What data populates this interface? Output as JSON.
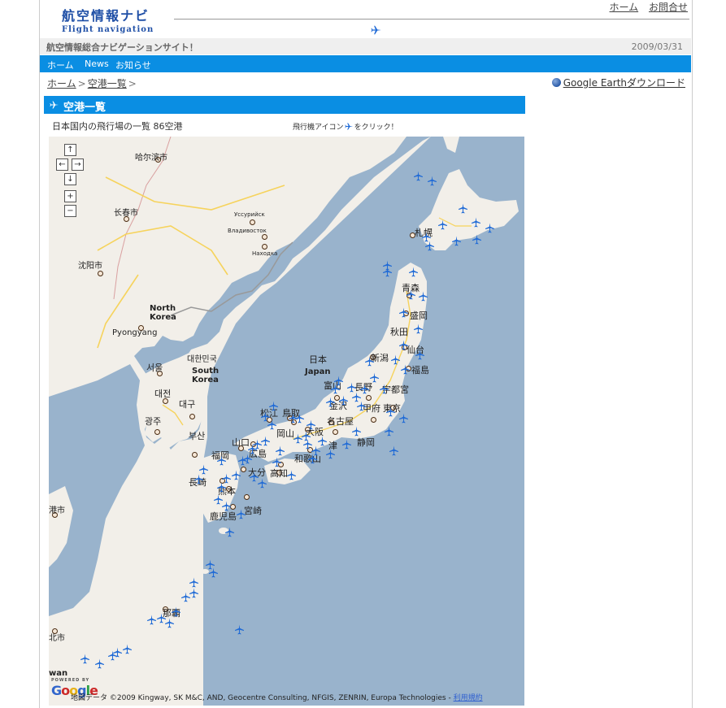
{
  "header": {
    "logo_jp": "航空情報ナビ",
    "logo_en": "Flight navigation",
    "top_links": [
      "ホーム",
      "お問合せ"
    ]
  },
  "tagline": {
    "text": "航空情報総合ナビゲーションサイト！",
    "date": "2009/03/31"
  },
  "nav": {
    "items": [
      "ホーム",
      "News",
      "お知らせ"
    ]
  },
  "breadcrumb": {
    "home": "ホーム",
    "current": "空港一覧"
  },
  "google_earth": {
    "label": "Google Earthダウンロード"
  },
  "section": {
    "title": "空港一覧",
    "count_text": "日本国内の飛行場の一覧  86空港",
    "hint_prefix": "飛行機アイコン",
    "hint_suffix": "をクリック！"
  },
  "map": {
    "controls": [
      "↑",
      "←",
      "→",
      "↓",
      "+",
      "−"
    ],
    "labels": {
      "harbin": "哈尔滨市",
      "changchun": "长春市",
      "shenyang": "沈阳市",
      "ussuriysk": "Уссурийск",
      "vladivostok": "Владивосток",
      "nakhodka": "Находка",
      "north_korea": "North",
      "north_korea2": "Korea",
      "pyongyang": "Pyongyang",
      "daehan": "대한민국",
      "south_korea": "South",
      "south_korea2": "Korea",
      "seoul": "서울",
      "daejeon": "대전",
      "daegu": "대구",
      "gwangju": "광주",
      "busan": "부산",
      "nihon": "日本",
      "japan": "Japan",
      "sapporo": "札幌",
      "aomori": "青森",
      "morioka": "盛岡",
      "akita": "秋田",
      "sendai": "仙台",
      "niigata": "新潟",
      "fukushima": "福島",
      "toyama": "富山",
      "nagano": "長野",
      "utsunomiya": "宇都宮",
      "kanazawa": "金沢",
      "kofu": "甲府",
      "tokyo": "東京",
      "matsue": "松江",
      "tottori": "鳥取",
      "okayama": "岡山",
      "osaka": "大阪",
      "nagoya": "名古屋",
      "shizuoka": "静岡",
      "yamaguchi": "山口",
      "hiroshima": "広島",
      "wakayama": "和歌山",
      "tsu": "津",
      "fukuoka": "福岡",
      "oita": "大分",
      "kochi": "高知",
      "nagasaki": "長崎",
      "kumamoto": "熊本",
      "kagoshima": "鹿児島",
      "miyazaki": "宮崎",
      "naha": "那覇",
      "taipei_fragment": "北市",
      "left_fragment": "港市",
      "taiwan_fragment": "wan"
    },
    "powered_by": "POWERED BY",
    "google": "Google",
    "attribution": "地図データ ©2009 Kingway, SK M&C, AND, Geocentre Consulting, NFGIS, ZENRIN, Europa Technologies -",
    "terms": "利用規約"
  },
  "colors": {
    "accent": "#0a8ee3",
    "sea": "#99b3cc",
    "land": "#f2efe9",
    "plane": "#1f6ad6"
  }
}
